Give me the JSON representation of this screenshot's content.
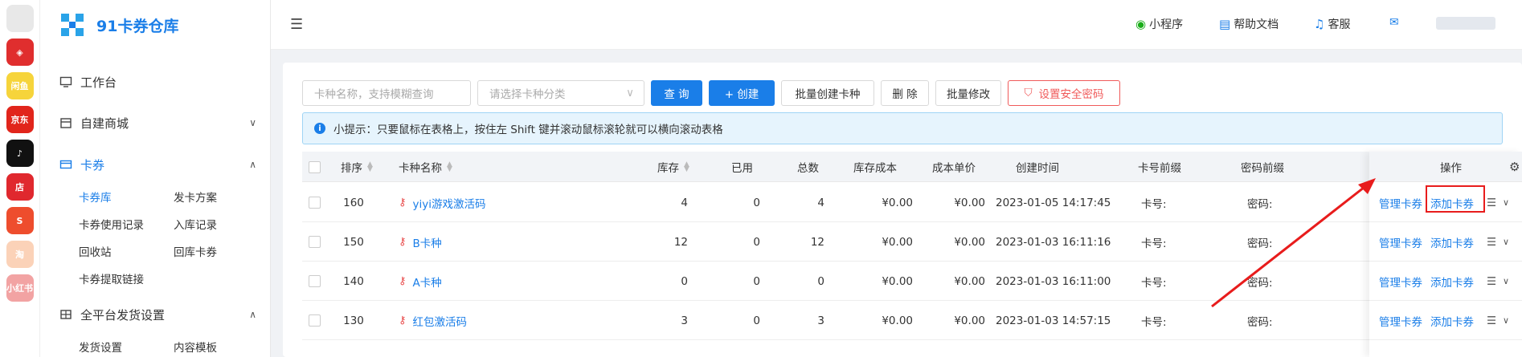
{
  "app": {
    "title": "91卡券仓库"
  },
  "rail": [
    {
      "name": "app-icon-1",
      "color": "#e8e8e8",
      "label": ""
    },
    {
      "name": "app-icon-2",
      "color": "#e02e2e",
      "label": "◈"
    },
    {
      "name": "app-icon-3",
      "color": "#f6d43b",
      "label": "闲鱼"
    },
    {
      "name": "app-icon-4",
      "color": "#e1251b",
      "label": "京东"
    },
    {
      "name": "app-icon-5",
      "color": "#111111",
      "label": "♪"
    },
    {
      "name": "app-icon-6",
      "color": "#e0282e",
      "label": "店"
    },
    {
      "name": "app-icon-7",
      "color": "#ee4d2d",
      "label": "S"
    },
    {
      "name": "app-icon-8",
      "color": "#fbd2b8",
      "label": "淘"
    },
    {
      "name": "app-icon-9",
      "color": "#f2a3a3",
      "label": "小红书"
    }
  ],
  "sidebar": {
    "workbench": "工作台",
    "mall": "自建商城",
    "card": "卡券",
    "sub_card": [
      "卡券库",
      "发卡方案",
      "卡券使用记录",
      "入库记录",
      "回收站",
      "回库卡券",
      "卡券提取链接"
    ],
    "platform": "全平台发货设置",
    "sub_platform": [
      "发货设置",
      "内容模板"
    ]
  },
  "topbar": {
    "miniapp": "小程序",
    "help": "帮助文档",
    "service": "客服"
  },
  "toolbar": {
    "search_placeholder": "卡种名称，支持模糊查询",
    "category_placeholder": "请选择卡种分类",
    "query": "查 询",
    "create": "+ 创建",
    "batch_create": "批量创建卡种",
    "delete": "删 除",
    "batch_edit": "批量修改",
    "security": "设置安全密码"
  },
  "tip": "小提示：只要鼠标在表格上，按住左 Shift 键并滚动鼠标滚轮就可以横向滚动表格",
  "table": {
    "headers": [
      "排序",
      "卡种名称",
      "库存",
      "已用",
      "总数",
      "库存成本",
      "成本单价",
      "创建时间",
      "卡号前缀",
      "密码前缀",
      "操作"
    ],
    "rows": [
      {
        "sort": "160",
        "name": "yiyi游戏激活码",
        "stock": "4",
        "used": "0",
        "total": "4",
        "cost": "¥0.00",
        "unit": "¥0.00",
        "time": "2023-01-05 14:17:45",
        "cardpre": "卡号:",
        "pwdpre": "密码:"
      },
      {
        "sort": "150",
        "name": "B卡种",
        "stock": "12",
        "used": "0",
        "total": "12",
        "cost": "¥0.00",
        "unit": "¥0.00",
        "time": "2023-01-03 16:11:16",
        "cardpre": "卡号:",
        "pwdpre": "密码:"
      },
      {
        "sort": "140",
        "name": "A卡种",
        "stock": "0",
        "used": "0",
        "total": "0",
        "cost": "¥0.00",
        "unit": "¥0.00",
        "time": "2023-01-03 16:11:00",
        "cardpre": "卡号:",
        "pwdpre": "密码:"
      },
      {
        "sort": "130",
        "name": "红包激活码",
        "stock": "3",
        "used": "0",
        "total": "3",
        "cost": "¥0.00",
        "unit": "¥0.00",
        "time": "2023-01-03 14:57:15",
        "cardpre": "卡号:",
        "pwdpre": "密码:"
      }
    ],
    "actions": {
      "manage": "管理卡券",
      "add": "添加卡券"
    }
  }
}
